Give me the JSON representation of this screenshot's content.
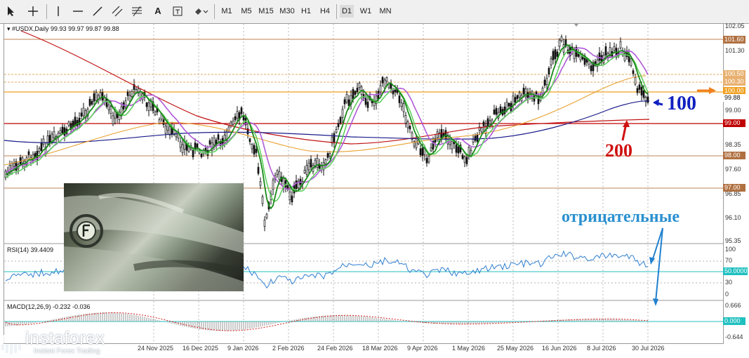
{
  "toolbar": {
    "tool_icons": [
      "cursor-icon",
      "crosshair-icon",
      "vertical-line-icon",
      "horizontal-line-icon",
      "trend-line-icon",
      "channel-icon",
      "fibonacci-icon",
      "text-icon",
      "label-icon",
      "shapes-icon"
    ],
    "timeframes": [
      "M1",
      "M5",
      "M15",
      "M30",
      "H1",
      "H4",
      "D1",
      "W1",
      "MN"
    ],
    "active_timeframe": "D1"
  },
  "chart": {
    "symbol_line": "#USDX,Daily  99.93 99.97 99.87 99.88",
    "price_axis": [
      "102.05",
      "101.30",
      "100.50",
      "100.30",
      "99.00",
      "98.35",
      "97.60",
      "96.85",
      "96.10",
      "95.35"
    ],
    "price_tags": [
      {
        "label": "101.60",
        "color": "#b07040"
      },
      {
        "label": "100.50",
        "color": "#e8b070"
      },
      {
        "label": "100.30",
        "color": "#e8b070"
      },
      {
        "label": "100.00",
        "color": "#f0a020"
      },
      {
        "label": "99.88",
        "color": "#ffffff"
      },
      {
        "label": "99.00",
        "color": "#c00000"
      },
      {
        "label": "98.00",
        "color": "#b07040"
      },
      {
        "label": "97.00",
        "color": "#b07040"
      }
    ],
    "dates": [
      "24 Nov 2025",
      "16 Dec 2025",
      "9 Jan 2026",
      "2 Feb 2026",
      "24 Feb 2026",
      "18 Mar 2026",
      "9 Apr 2026",
      "1 May 2026",
      "25 May 2026",
      "16 Jun 2026",
      "8 Jul 2026",
      "30 Jul 2026"
    ]
  },
  "rsi": {
    "title": "RSI(14) 39.4409",
    "axis": [
      "100",
      "70",
      "50.0000",
      "30",
      "0"
    ]
  },
  "macd": {
    "title": "MACD(12,26,9) -0.232 -0.036",
    "axis": [
      "0.666",
      "0.000",
      "-0.644"
    ]
  },
  "annotations": {
    "ma100": "100",
    "ma200": "200",
    "negative_label": "отрицательные"
  },
  "logo": {
    "brand": "instaforex",
    "tagline": "Instant Forex Trading"
  },
  "colors": {
    "ma_green": "#1a9a1a",
    "ma_light_green": "#5ad25a",
    "ma_violet": "#b05ad8",
    "ma100_blue": "#1a1a9a",
    "ma200_red": "#c01010",
    "ma_orange": "#e8a030",
    "candle": "#111111",
    "rsi_line": "#2f7fd0",
    "rsi_level": "#20c0c0"
  }
}
